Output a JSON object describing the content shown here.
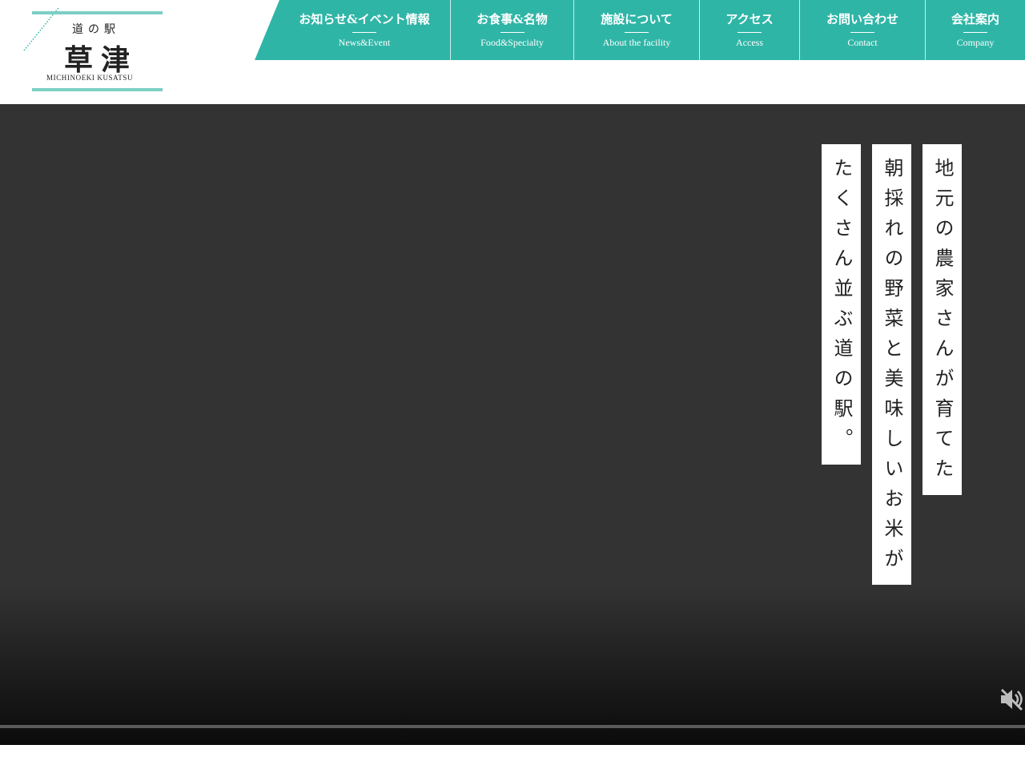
{
  "logo": {
    "small": "道の駅",
    "big": "草津",
    "roman": "MICHINOEKI KUSATSU"
  },
  "nav": {
    "items": [
      {
        "jp": "お知らせ&イベント情報",
        "en": "News&Event"
      },
      {
        "jp": "お食事&名物",
        "en": "Food&Specialty"
      },
      {
        "jp": "施設について",
        "en": "About the facility"
      },
      {
        "jp": "アクセス",
        "en": "Access"
      },
      {
        "jp": "お問い合わせ",
        "en": "Contact"
      },
      {
        "jp": "会社案内",
        "en": "Company"
      }
    ]
  },
  "hero": {
    "tagline_lines": [
      "地元の農家さんが育てた",
      "朝採れの野菜と美味しいお米が",
      "たくさん並ぶ道の駅。"
    ],
    "mute_icon": "speaker-muted-icon"
  },
  "colors": {
    "accent": "#2fb5a6",
    "logo_bar": "#7ccfc4",
    "video_bg": "#333333"
  }
}
